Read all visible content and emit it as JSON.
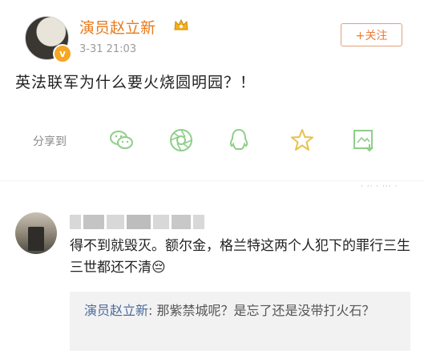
{
  "post": {
    "username": "演员赵立新",
    "time": "3-31 21:03",
    "follow_label": "+关注",
    "text": "英法联军为什么要火烧圆明园？！",
    "share_label": "分享到",
    "share_icons": [
      "wechat-icon",
      "moments-icon",
      "qq-icon",
      "qzone-star-icon",
      "save-image-icon"
    ]
  },
  "comment": {
    "text": "得不到就毁灭。额尔金，格兰特这两个人犯下的罪行三生三世都还不清😔",
    "reply": {
      "name": "演员赵立新",
      "sep": ": ",
      "text": "那紫禁城呢？是忘了还是没带打火石？"
    }
  },
  "colors": {
    "accent": "#e8791b",
    "share_icon": "#8fce8a",
    "reply_name": "#4a6b9c"
  }
}
